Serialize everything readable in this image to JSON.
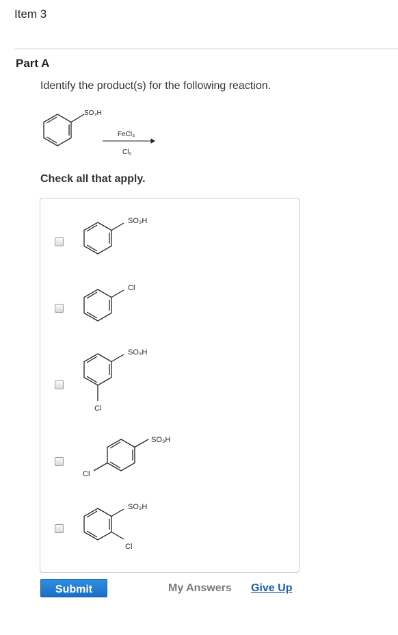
{
  "item": {
    "title": "Item 3"
  },
  "part": {
    "title": "Part A"
  },
  "question": {
    "text": "Identify the product(s) for the following reaction."
  },
  "reaction": {
    "reactant_substituent": "SO₃H",
    "reagent_top": "FeCl₃",
    "reagent_bottom": "Cl₂"
  },
  "instructions": {
    "check_all": "Check all that apply."
  },
  "options": [
    {
      "labels": [
        "SO₃H"
      ],
      "checked": false
    },
    {
      "labels": [
        "Cl"
      ],
      "checked": false
    },
    {
      "labels": [
        "SO₃H",
        "Cl"
      ],
      "checked": false
    },
    {
      "labels": [
        "SO₃H",
        "Cl"
      ],
      "checked": false
    },
    {
      "labels": [
        "SO₃H",
        "Cl"
      ],
      "checked": false
    }
  ],
  "actions": {
    "submit_label": "Submit",
    "my_answers_label": "My Answers",
    "give_up_label": "Give Up"
  }
}
